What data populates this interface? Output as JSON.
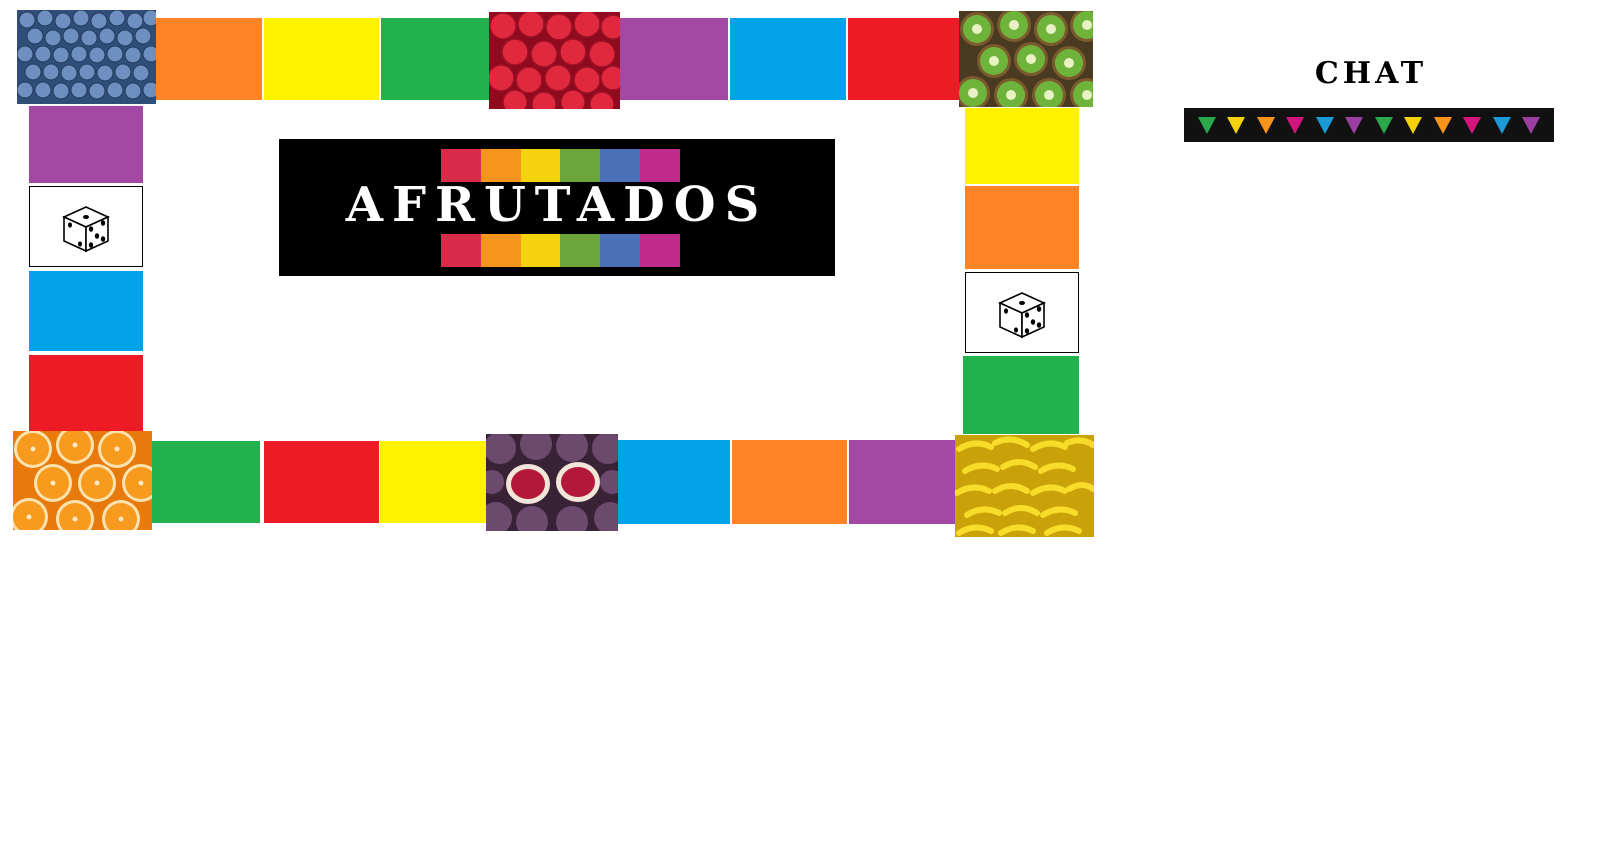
{
  "banner": {
    "title": "AFRUTADOS",
    "strip_colors": [
      "#d92b4a",
      "#f7941d",
      "#f5d20e",
      "#6aa63a",
      "#4a70b8",
      "#c02a8a"
    ]
  },
  "chat": {
    "title": "CHAT",
    "markers": [
      "#2aa84a",
      "#f5d20e",
      "#f7941d",
      "#d4147d",
      "#1a9ad6",
      "#9a3fa0",
      "#2aa84a",
      "#f5d20e",
      "#f7941d",
      "#d4147d",
      "#1a9ad6",
      "#9a3fa0"
    ]
  },
  "board": {
    "fruit_tiles": [
      "blueberries",
      "raspberries",
      "kiwis",
      "oranges",
      "figs",
      "bananas"
    ],
    "dice_tiles": [
      "dice-left",
      "dice-right"
    ],
    "colors": {
      "orange": "#fd8324",
      "yellow": "#fff200",
      "green": "#22b14c",
      "purple": "#a349a4",
      "blue": "#00a2e8",
      "red": "#ed1c24"
    }
  }
}
